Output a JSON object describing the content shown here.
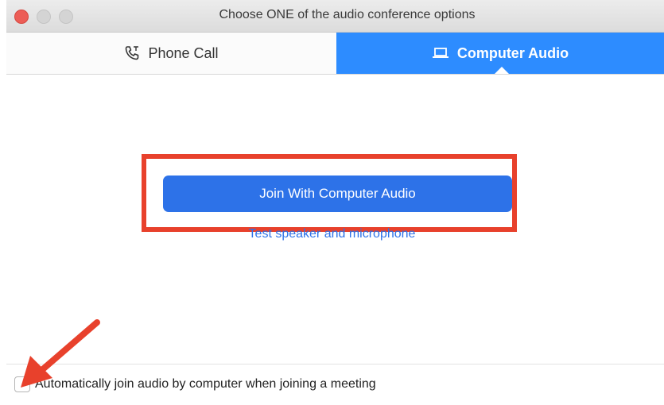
{
  "window": {
    "title": "Choose ONE of the audio conference options"
  },
  "tabs": [
    {
      "label": "Phone Call",
      "icon": "phone-icon",
      "selected": false
    },
    {
      "label": "Computer Audio",
      "icon": "laptop-icon",
      "selected": true
    }
  ],
  "main": {
    "join_button_label": "Join With Computer Audio",
    "test_link_label": "Test speaker and microphone"
  },
  "footer": {
    "auto_join_label": "Automatically join audio by computer when joining a meeting",
    "auto_join_checked": false
  },
  "colors": {
    "accent": "#2d8cff",
    "button": "#2d72e8",
    "annotation": "#e8412c"
  }
}
